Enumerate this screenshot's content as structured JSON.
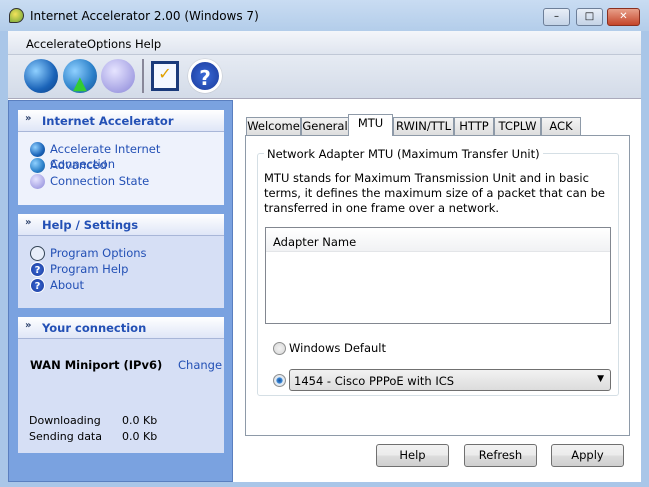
{
  "window": {
    "title": "Internet Accelerator 2.00 (Windows 7)",
    "minimize": "–",
    "maximize": "□",
    "close": "✕"
  },
  "menu": [
    "Accelerate",
    "Options",
    "Help"
  ],
  "toolbar": {
    "icons": [
      "globe-accelerate-icon",
      "globe-advanced-icon",
      "pie-chart-icon",
      "options-checklist-icon",
      "help-icon"
    ]
  },
  "sidebar": {
    "sections": [
      {
        "title": "Internet Accelerator",
        "items": [
          {
            "label": "Accelerate Internet Connection",
            "icon": "globe-icon"
          },
          {
            "label": "Advanced",
            "icon": "globe-arrow-icon"
          },
          {
            "label": "Connection State",
            "icon": "pie-chart-icon"
          }
        ]
      },
      {
        "title": "Help / Settings",
        "items": [
          {
            "label": "Program Options",
            "icon": "options-icon"
          },
          {
            "label": "Program Help",
            "icon": "help-icon"
          },
          {
            "label": "About",
            "icon": "help-icon"
          }
        ]
      },
      {
        "title": "Your connection"
      }
    ],
    "connection": {
      "name": "WAN Miniport (IPv6)",
      "change": "Change",
      "downloading_label": "Downloading",
      "downloading_value": "0.0 Kb",
      "sending_label": "Sending data",
      "sending_value": "0.0 Kb"
    }
  },
  "tabs": [
    "Welcome",
    "General",
    "MTU",
    "RWIN/TTL",
    "HTTP",
    "TCPLW",
    "ACK"
  ],
  "active_tab": "MTU",
  "mtu": {
    "group_title": "Network Adapter MTU (Maximum Transfer Unit)",
    "description": "MTU stands for Maximum Transmission Unit and in basic terms, it defines the maximum size of a packet that can be transferred in one frame over a network.",
    "list_header": "Adapter Name",
    "radio_default": "Windows Default",
    "combo_value": "1454 - Cisco PPPoE with ICS",
    "selected": "combo"
  },
  "buttons": {
    "help": "Help",
    "refresh": "Refresh",
    "apply": "Apply"
  }
}
